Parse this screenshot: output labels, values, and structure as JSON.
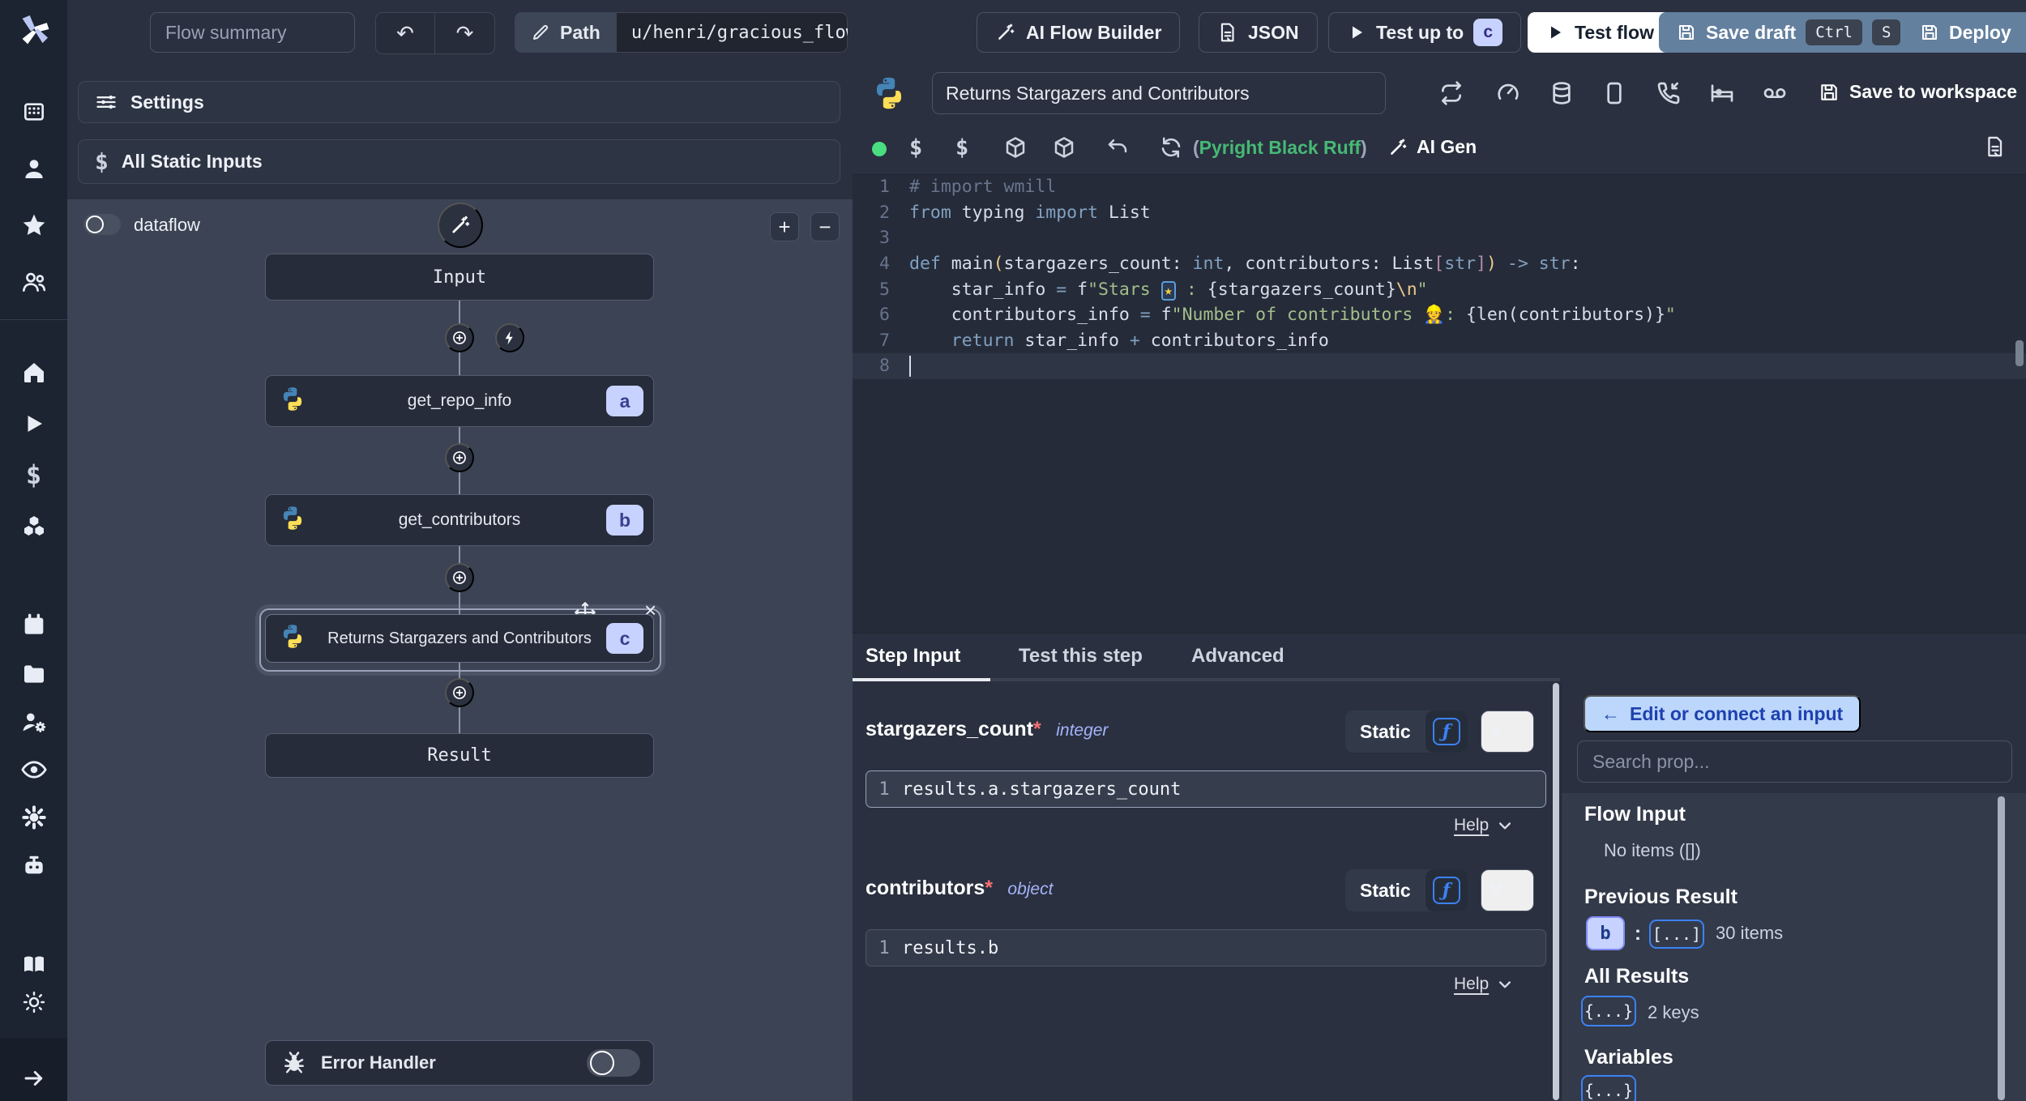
{
  "colors": {
    "accent_steel_blue": "#64809f",
    "light_blue_button_bg": "#bcd7fb",
    "light_blue_button_text": "#1e40af",
    "badge_bg": "#c7d2fe",
    "badge_text": "#312e81",
    "status_green": "#4ade80",
    "assistant_green": "#46b975",
    "code_keyword": "#81a1c1",
    "code_string": "#a3be8c",
    "code_comment": "#69758e",
    "canvas_bg": "#3b4354"
  },
  "topbar": {
    "flow_summary_placeholder": "Flow summary",
    "path_label": "Path",
    "path_value": "u/henri/gracious_flow",
    "ai_flow_builder": "AI Flow Builder",
    "json": "JSON",
    "test_up_to": "Test up to",
    "test_up_to_badge": "c",
    "test_flow": "Test flow",
    "save_draft": "Save draft",
    "kbd_ctrl": "Ctrl",
    "kbd_s": "S",
    "deploy": "Deploy"
  },
  "flow_panel": {
    "settings": "Settings",
    "all_static_inputs": "All Static Inputs",
    "dataflow_label": "dataflow",
    "zoom_in": "+",
    "zoom_out": "−",
    "input_node": "Input",
    "result_node": "Result",
    "error_handler": "Error Handler",
    "steps": [
      {
        "label": "get_repo_info",
        "badge": "a"
      },
      {
        "label": "get_contributors",
        "badge": "b"
      },
      {
        "label": "Returns Stargazers and Contributors",
        "badge": "c"
      }
    ]
  },
  "editor": {
    "title": "Returns Stargazers and Contributors",
    "save_to_workspace": "Save to workspace",
    "assistant_paren_open": "(",
    "assistant_text": "Pyright Black Ruff",
    "assistant_paren_close": ")",
    "ai_gen": "AI Gen",
    "code": {
      "active_line": 8,
      "lines": [
        [
          [
            "c",
            "# import wmill"
          ]
        ],
        [
          [
            "k",
            "from"
          ],
          [
            "p",
            " typing "
          ],
          [
            "k",
            "import"
          ],
          [
            "p",
            " List"
          ]
        ],
        [],
        [
          [
            "k",
            "def"
          ],
          [
            "p",
            " main"
          ],
          [
            "y",
            "("
          ],
          [
            "p",
            "stargazers_count: "
          ],
          [
            "k",
            "int"
          ],
          [
            "p",
            ", contributors: List"
          ],
          [
            "m",
            "["
          ],
          [
            "k",
            "str"
          ],
          [
            "m",
            "]"
          ],
          [
            "y",
            ")"
          ],
          [
            "k",
            " -> "
          ],
          [
            "k",
            "str"
          ],
          [
            "p",
            ":"
          ]
        ],
        [
          [
            "p",
            "    star_info "
          ],
          [
            "k",
            "="
          ],
          [
            "p",
            " f"
          ],
          [
            "s",
            "\"Stars "
          ],
          [
            "E",
            "★"
          ],
          [
            "s",
            " : "
          ],
          [
            "p",
            "{stargazers_count}"
          ],
          [
            "e",
            "\\n"
          ],
          [
            "s",
            "\""
          ]
        ],
        [
          [
            "p",
            "    contributors_info "
          ],
          [
            "k",
            "="
          ],
          [
            "p",
            " f"
          ],
          [
            "s",
            "\"Number of contributors "
          ],
          [
            "W",
            "👷"
          ],
          [
            "s",
            ": "
          ],
          [
            "p",
            "{len(contributors)}"
          ],
          [
            "s",
            "\""
          ]
        ],
        [
          [
            "k",
            "    return"
          ],
          [
            "p",
            " star_info "
          ],
          [
            "k",
            "+"
          ],
          [
            "p",
            " contributors_info"
          ]
        ],
        []
      ]
    }
  },
  "step_panel": {
    "tabs": [
      "Step Input",
      "Test this step",
      "Advanced"
    ],
    "fields": [
      {
        "name": "stargazers_count",
        "required": "*",
        "type": "integer",
        "mode": "Static",
        "line_no": "1",
        "expr": "results.a.stargazers_count",
        "help": "Help"
      },
      {
        "name": "contributors",
        "required": "*",
        "type": "object",
        "mode": "Static",
        "line_no": "1",
        "expr": "results.b",
        "help": "Help"
      }
    ]
  },
  "connect_panel": {
    "edit_arrow": "←",
    "edit_button": "Edit or connect an input",
    "search_placeholder": "Search prop...",
    "flow_input_title": "Flow Input",
    "flow_input_empty": "No items ([])",
    "previous_result_title": "Previous Result",
    "previous_result_badge": "b",
    "previous_result_colon": ":",
    "previous_result_collapsed": "[...]",
    "previous_result_count": "30 items",
    "all_results_title": "All Results",
    "all_results_collapsed": "{...}",
    "all_results_count": "2 keys",
    "variables_title": "Variables",
    "variables_collapsed": "{...}"
  }
}
